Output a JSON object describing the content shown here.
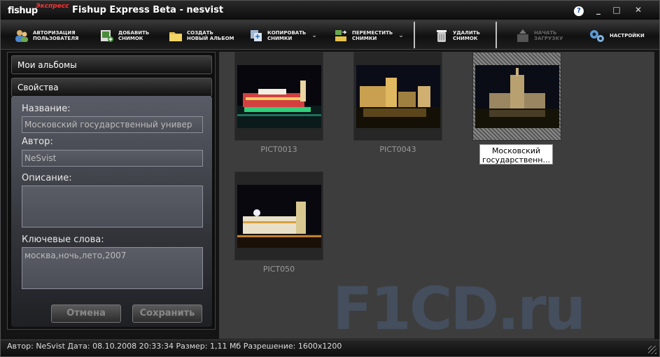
{
  "titlebar": {
    "logo_main": "fishup",
    "logo_sub": "Экспресс",
    "title": "Fishup Express Beta - nesvist",
    "help_label": "?",
    "min_label": "_",
    "max_label": "□",
    "close_label": "✕"
  },
  "toolbar": {
    "auth": "Авторизация\nпользователя",
    "add": "добавить\nснимок",
    "create_album": "создать\nновый альбом",
    "copy": "копировать\nснимки",
    "move": "переместить\nснимки",
    "delete": "удалить\nснимок",
    "start_upload": "начать\nзагрузку",
    "settings": "настройки"
  },
  "sidebar": {
    "albums_header": "Мои альбомы",
    "props_header": "Свойства",
    "name_label": "Название:",
    "name_value": "Московский государственный универ",
    "author_label": "Автор:",
    "author_value": "NeSvist",
    "desc_label": "Описание:",
    "desc_value": "",
    "keywords_label": "Ключевые слова:",
    "keywords_value": "москва,ночь,лето,2007",
    "cancel_label": "Отмена",
    "save_label": "Сохранить"
  },
  "photos": [
    {
      "caption": "PICT0013"
    },
    {
      "caption": "PICT0043"
    },
    {
      "caption": "Московский государственн..."
    },
    {
      "caption": "PICT050"
    }
  ],
  "watermark": "F1CD.ru",
  "statusbar": {
    "text": "Автор: NeSvist  Дата: 08.10.2008 20:33:34  Размер: 1,11 Мб  Разрешение: 1600x1200"
  }
}
